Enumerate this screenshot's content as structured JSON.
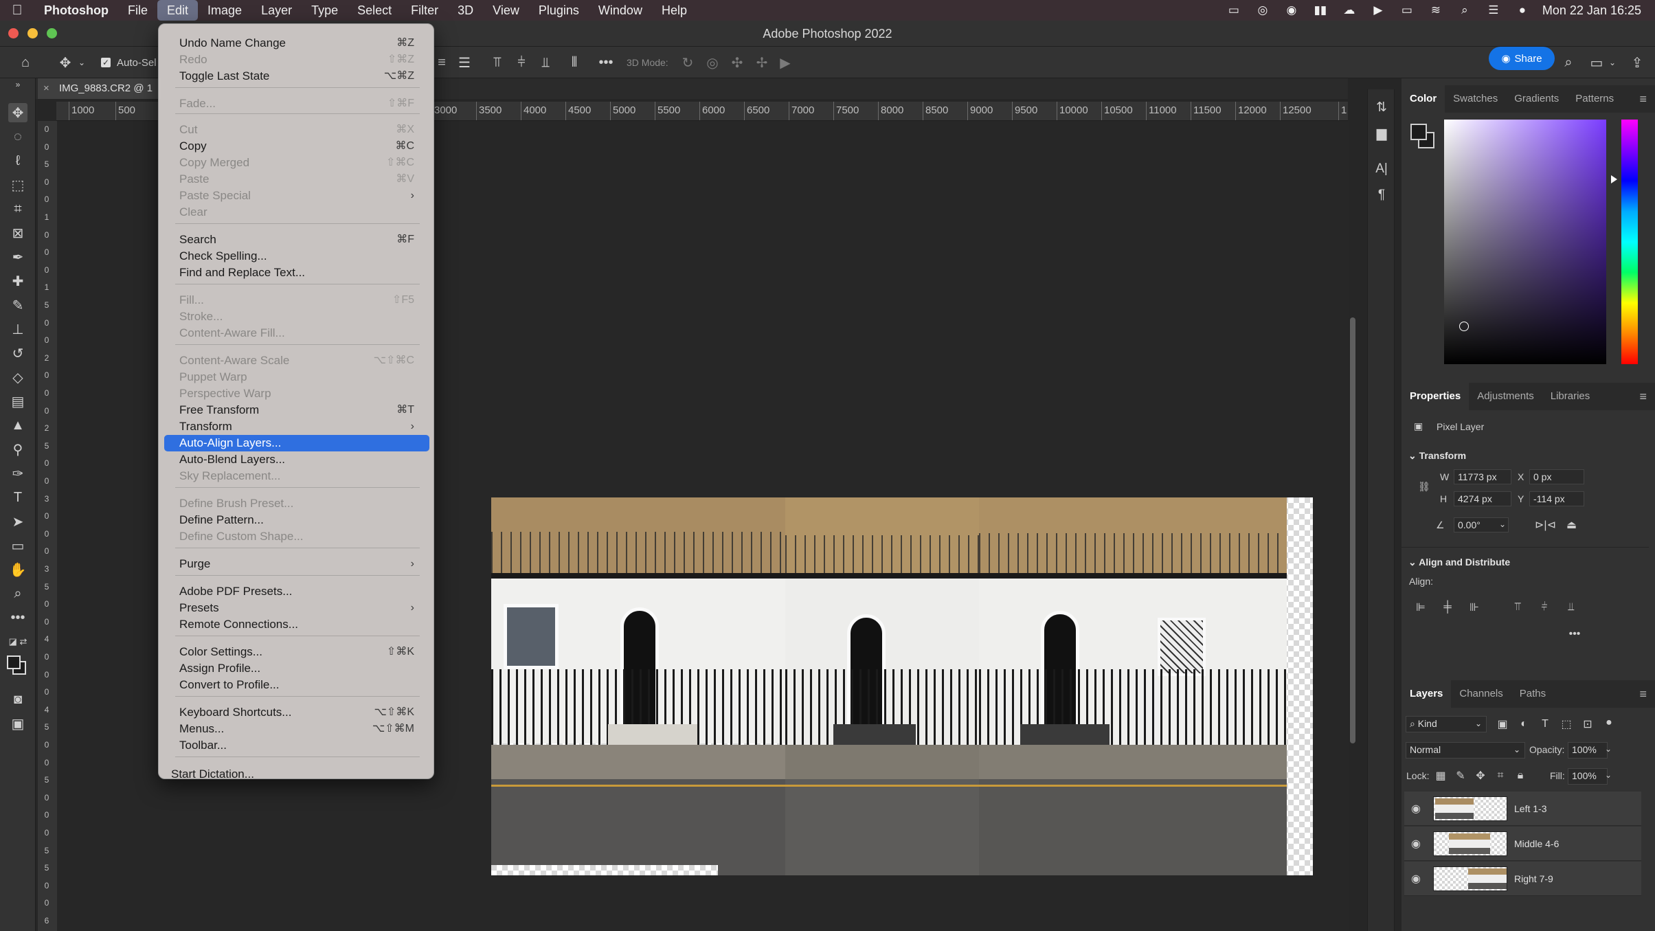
{
  "menubar": {
    "items": [
      "Photoshop",
      "File",
      "Edit",
      "Image",
      "Layer",
      "Type",
      "Select",
      "Filter",
      "3D",
      "View",
      "Plugins",
      "Window",
      "Help"
    ],
    "active": "Edit",
    "clock": "Mon 22 Jan  16:25"
  },
  "titlebar": {
    "title": "Adobe Photoshop 2022"
  },
  "options": {
    "auto_select_label": "Auto-Sel",
    "mode_3d_label": "3D Mode:",
    "share_label": "Share"
  },
  "document": {
    "tab_label": "IMG_9883.CR2 @ 1"
  },
  "ruler": {
    "h_ticks": [
      "1000",
      "500",
      "3000",
      "3500",
      "4000",
      "4500",
      "5000",
      "5500",
      "6000",
      "6500",
      "7000",
      "7500",
      "8000",
      "8500",
      "9000",
      "9500",
      "10000",
      "10500",
      "11000",
      "11500",
      "12000",
      "12500",
      "1"
    ],
    "v_ticks": [
      "0",
      "0",
      "5",
      "0",
      "0",
      "1",
      "0",
      "0",
      "0",
      "1",
      "5",
      "0",
      "0",
      "2",
      "0",
      "0",
      "0",
      "2",
      "5",
      "0",
      "0",
      "3",
      "0",
      "0",
      "0",
      "3",
      "5",
      "0",
      "0",
      "4",
      "0",
      "0",
      "0",
      "4",
      "5",
      "0",
      "0",
      "5",
      "0",
      "0",
      "0",
      "5",
      "5",
      "0",
      "0",
      "6"
    ]
  },
  "edit_menu": {
    "items": [
      {
        "label": "Undo Name Change",
        "shortcut": "⌘Z",
        "enabled": true
      },
      {
        "label": "Redo",
        "shortcut": "⇧⌘Z",
        "enabled": false
      },
      {
        "label": "Toggle Last State",
        "shortcut": "⌥⌘Z",
        "enabled": true
      },
      {
        "label": "Fade...",
        "shortcut": "⇧⌘F",
        "enabled": false
      },
      {
        "label": "Cut",
        "shortcut": "⌘X",
        "enabled": false
      },
      {
        "label": "Copy",
        "shortcut": "⌘C",
        "enabled": true
      },
      {
        "label": "Copy Merged",
        "shortcut": "⇧⌘C",
        "enabled": false
      },
      {
        "label": "Paste",
        "shortcut": "⌘V",
        "enabled": false
      },
      {
        "label": "Paste Special",
        "shortcut": "›",
        "enabled": false
      },
      {
        "label": "Clear",
        "shortcut": "",
        "enabled": false
      },
      {
        "label": "Search",
        "shortcut": "⌘F",
        "enabled": true
      },
      {
        "label": "Check Spelling...",
        "shortcut": "",
        "enabled": true
      },
      {
        "label": "Find and Replace Text...",
        "shortcut": "",
        "enabled": true
      },
      {
        "label": "Fill...",
        "shortcut": "⇧F5",
        "enabled": false
      },
      {
        "label": "Stroke...",
        "shortcut": "",
        "enabled": false
      },
      {
        "label": "Content-Aware Fill...",
        "shortcut": "",
        "enabled": false
      },
      {
        "label": "Content-Aware Scale",
        "shortcut": "⌥⇧⌘C",
        "enabled": false
      },
      {
        "label": "Puppet Warp",
        "shortcut": "",
        "enabled": false
      },
      {
        "label": "Perspective Warp",
        "shortcut": "",
        "enabled": false
      },
      {
        "label": "Free Transform",
        "shortcut": "⌘T",
        "enabled": true
      },
      {
        "label": "Transform",
        "shortcut": "›",
        "enabled": true
      },
      {
        "label": "Auto-Align Layers...",
        "shortcut": "",
        "enabled": true,
        "highlighted": true
      },
      {
        "label": "Auto-Blend Layers...",
        "shortcut": "",
        "enabled": true
      },
      {
        "label": "Sky Replacement...",
        "shortcut": "",
        "enabled": false
      },
      {
        "label": "Define Brush Preset...",
        "shortcut": "",
        "enabled": false
      },
      {
        "label": "Define Pattern...",
        "shortcut": "",
        "enabled": true
      },
      {
        "label": "Define Custom Shape...",
        "shortcut": "",
        "enabled": false
      },
      {
        "label": "Purge",
        "shortcut": "›",
        "enabled": true
      },
      {
        "label": "Adobe PDF Presets...",
        "shortcut": "",
        "enabled": true
      },
      {
        "label": "Presets",
        "shortcut": "›",
        "enabled": true
      },
      {
        "label": "Remote Connections...",
        "shortcut": "",
        "enabled": true
      },
      {
        "label": "Color Settings...",
        "shortcut": "⇧⌘K",
        "enabled": true
      },
      {
        "label": "Assign Profile...",
        "shortcut": "",
        "enabled": true
      },
      {
        "label": "Convert to Profile...",
        "shortcut": "",
        "enabled": true
      },
      {
        "label": "Keyboard Shortcuts...",
        "shortcut": "⌥⇧⌘K",
        "enabled": true
      },
      {
        "label": "Menus...",
        "shortcut": "⌥⇧⌘M",
        "enabled": true
      },
      {
        "label": "Toolbar...",
        "shortcut": "",
        "enabled": true
      },
      {
        "label": "Start Dictation...",
        "shortcut": "",
        "enabled": true
      }
    ]
  },
  "color_panel": {
    "tabs": [
      "Color",
      "Swatches",
      "Gradients",
      "Patterns"
    ],
    "active_tab": "Color",
    "foreground": "#1d1d1d",
    "hue_color": "#7a3cff"
  },
  "properties_panel": {
    "tabs": [
      "Properties",
      "Adjustments",
      "Libraries"
    ],
    "active_tab": "Properties",
    "layer_type": "Pixel Layer",
    "transform_title": "Transform",
    "w_label": "W",
    "w_value": "11773 px",
    "h_label": "H",
    "h_value": "4274 px",
    "x_label": "X",
    "x_value": "0 px",
    "y_label": "Y",
    "y_value": "-114 px",
    "angle_value": "0.00°",
    "align_title": "Align and Distribute",
    "align_label": "Align:"
  },
  "layers_panel": {
    "tabs": [
      "Layers",
      "Channels",
      "Paths"
    ],
    "active_tab": "Layers",
    "filter_label": "Kind",
    "blend_mode": "Normal",
    "opacity_label": "Opacity:",
    "opacity_value": "100%",
    "lock_label": "Lock:",
    "fill_label": "Fill:",
    "fill_value": "100%",
    "layers": [
      {
        "name": "Left 1-3"
      },
      {
        "name": "Middle 4-6"
      },
      {
        "name": "Right 7-9"
      }
    ]
  }
}
